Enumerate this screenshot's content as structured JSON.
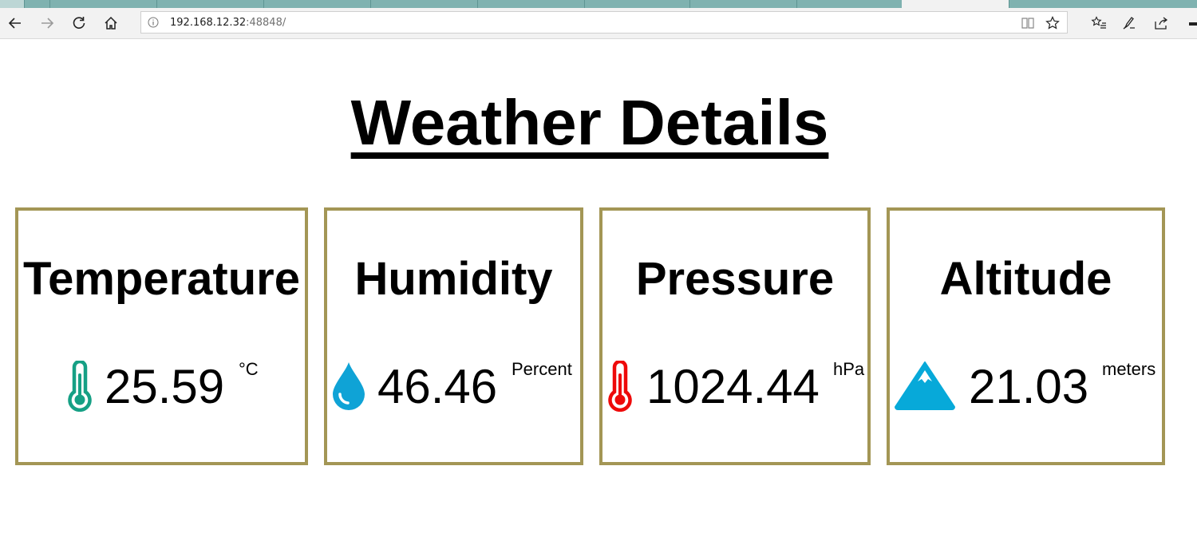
{
  "browser": {
    "address": {
      "host": "192.168.12.32",
      "port": ":48848/"
    }
  },
  "page": {
    "title": "Weather Details"
  },
  "cards": [
    {
      "name": "Temperature",
      "value": "25.59",
      "unit": "°C",
      "icon": "thermometer-icon",
      "color": "#16a085"
    },
    {
      "name": "Humidity",
      "value": "46.46",
      "unit": "Percent",
      "icon": "water-drop-icon",
      "color": "#0fa3d6"
    },
    {
      "name": "Pressure",
      "value": "1024.44",
      "unit": "hPa",
      "icon": "thermometer-icon",
      "color": "#ee0a0a"
    },
    {
      "name": "Altitude",
      "value": "21.03",
      "unit": "meters",
      "icon": "mountain-icon",
      "color": "#07a9d9"
    }
  ],
  "colors": {
    "card_border": "#a39655",
    "tabstrip": "#7fb2b0"
  }
}
